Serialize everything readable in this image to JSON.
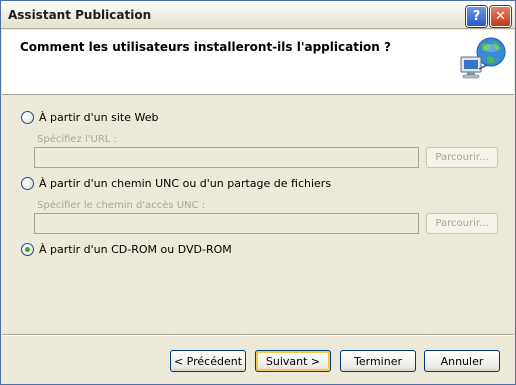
{
  "window": {
    "title": "Assistant Publication",
    "help_glyph": "?",
    "close_glyph": "✕"
  },
  "header": {
    "question": "Comment les utilisateurs installeront-ils l'application ?",
    "icon": "network-globe-computer-icon"
  },
  "options": [
    {
      "label": "À partir d'un site Web",
      "checked": false,
      "field_label": "Spécifiez l'URL :",
      "field_value": "",
      "browse_label": "Parcourir..."
    },
    {
      "label": "À partir d'un chemin UNC ou d'un partage de fichiers",
      "checked": false,
      "field_label": "Spécifier le chemin d'accès UNC :",
      "field_value": "",
      "browse_label": "Parcourir..."
    },
    {
      "label": "À partir d'un CD-ROM ou DVD-ROM",
      "checked": true
    }
  ],
  "buttons": {
    "previous": "< Précédent",
    "next": "Suivant >",
    "finish": "Terminer",
    "cancel": "Annuler"
  },
  "colors": {
    "accent_radio": "#31a931",
    "disabled_text": "#a7a692",
    "dialog_bg": "#ece9d8"
  }
}
